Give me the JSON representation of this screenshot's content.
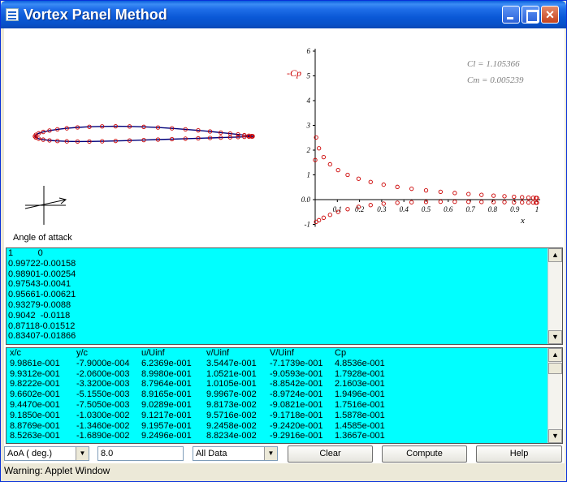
{
  "window": {
    "title": "Vortex Panel Method"
  },
  "plot": {
    "cp_label": "-Cp",
    "x_label": "x",
    "cl_text": "Cl = 1.105366",
    "cm_text": "Cm = 0.005239",
    "y_ticks": [
      "6",
      "5",
      "4",
      "3",
      "2",
      "1",
      "0.0",
      "-1"
    ],
    "x_ticks": [
      "0.1",
      "0.2",
      "0.3",
      "0.4",
      "0.5",
      "0.6",
      "0.7",
      "0.8",
      "0.9",
      "1"
    ],
    "colors": {
      "points": "#cc0000",
      "airfoil": "#00007a",
      "axis": "#000000",
      "annotation": "#808080"
    }
  },
  "angle_label": "Angle of attack",
  "coords": {
    "lines": [
      "1          0",
      "0.99722-0.00158",
      "0.98901-0.00254",
      "0.97543-0.0041",
      "0.95661-0.00621",
      "0.93279-0.0088",
      "0.9042  -0.0118",
      "0.87118-0.01512",
      "0.83407-0.01866"
    ]
  },
  "results": {
    "headers": [
      "x/c",
      "y/c",
      "u/Uinf",
      "v/Uinf",
      "V/Uinf",
      "Cp"
    ],
    "rows": [
      [
        "9.9861e-001",
        "-7.9000e-004",
        "6.2369e-001",
        "3.5447e-001",
        "-7.1739e-001",
        "4.8536e-001"
      ],
      [
        "9.9312e-001",
        "-2.0600e-003",
        "8.9980e-001",
        "1.0521e-001",
        "-9.0593e-001",
        "1.7928e-001"
      ],
      [
        "9.8222e-001",
        "-3.3200e-003",
        "8.7964e-001",
        "1.0105e-001",
        "-8.8542e-001",
        "2.1603e-001"
      ],
      [
        "9.6602e-001",
        "-5.1550e-003",
        "8.9165e-001",
        "9.9967e-002",
        "-8.9724e-001",
        "1.9496e-001"
      ],
      [
        "9.4470e-001",
        "-7.5050e-003",
        "9.0289e-001",
        "9.8173e-002",
        "-9.0821e-001",
        "1.7516e-001"
      ],
      [
        "9.1850e-001",
        "-1.0300e-002",
        "9.1217e-001",
        "9.5716e-002",
        "-9.1718e-001",
        "1.5878e-001"
      ],
      [
        "8.8769e-001",
        "-1.3460e-002",
        "9.1957e-001",
        "9.2458e-002",
        "-9.2420e-001",
        "1.4585e-001"
      ],
      [
        "8.5263e-001",
        "-1.6890e-002",
        "9.2496e-001",
        "8.8234e-002",
        "-9.2916e-001",
        "1.3667e-001"
      ]
    ]
  },
  "controls": {
    "aoa_select": "AoA ( deg.)",
    "aoa_value": "8.0",
    "data_select": "All Data",
    "clear": "Clear",
    "compute": "Compute",
    "help": "Help"
  },
  "status": "Warning: Applet Window"
}
